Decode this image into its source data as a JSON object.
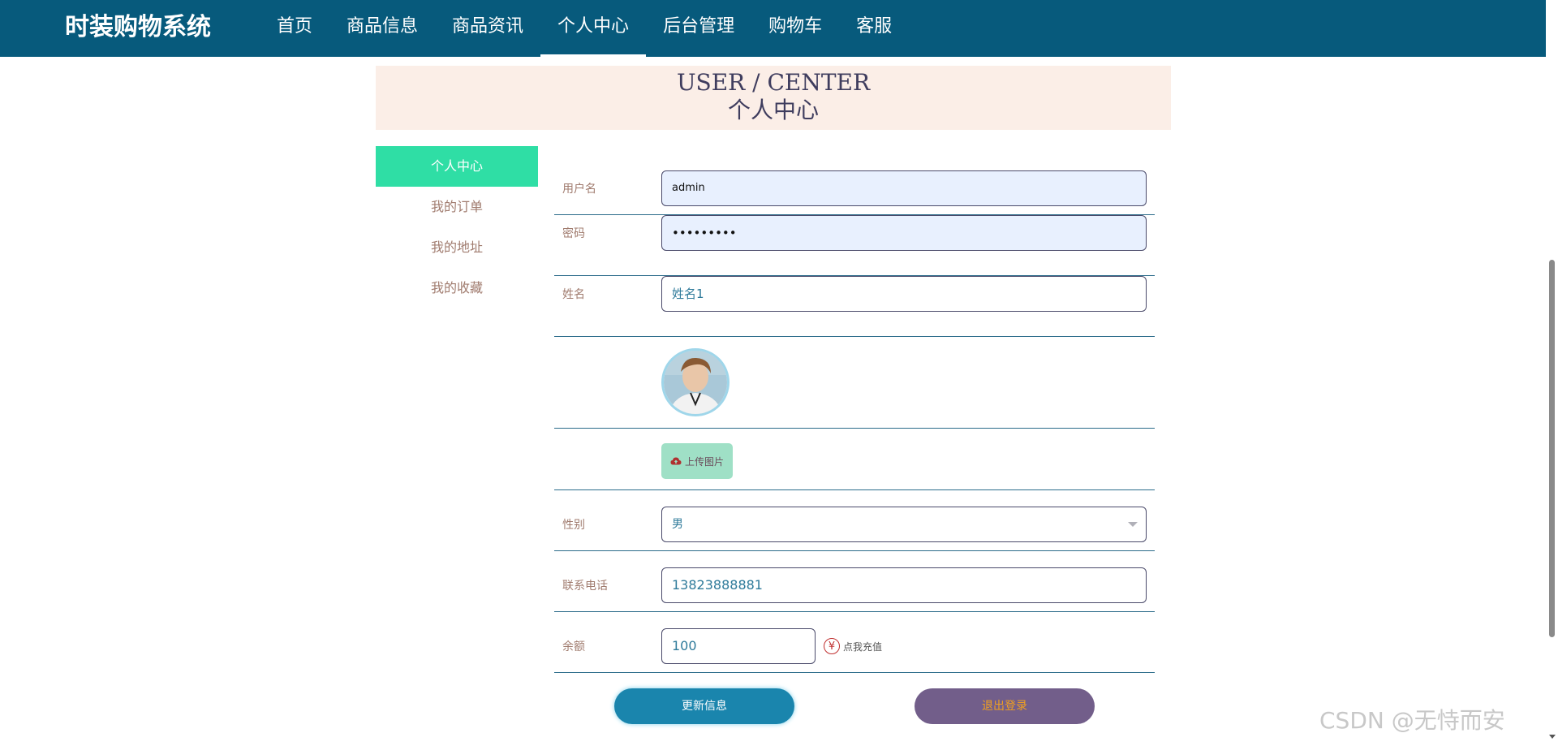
{
  "nav": {
    "brand": "时装购物系统",
    "items": [
      {
        "label": "首页"
      },
      {
        "label": "商品信息"
      },
      {
        "label": "商品资讯"
      },
      {
        "label": "个人中心",
        "active": true
      },
      {
        "label": "后台管理"
      },
      {
        "label": "购物车"
      },
      {
        "label": "客服"
      }
    ]
  },
  "banner": {
    "en": "USER / CENTER",
    "cn": "个人中心"
  },
  "side_menu": [
    {
      "label": "个人中心",
      "active": true
    },
    {
      "label": "我的订单"
    },
    {
      "label": "我的地址"
    },
    {
      "label": "我的收藏"
    }
  ],
  "form": {
    "username": {
      "label": "用户名",
      "value": "admin"
    },
    "password": {
      "label": "密码",
      "value": "•••••••••"
    },
    "name": {
      "label": "姓名",
      "value": "姓名1"
    },
    "upload_label": "上传图片",
    "gender": {
      "label": "性别",
      "value": "男"
    },
    "phone": {
      "label": "联系电话",
      "value": "13823888881"
    },
    "balance": {
      "label": "余额",
      "value": "100",
      "recharge_label": "点我充值"
    }
  },
  "buttons": {
    "update": "更新信息",
    "logout": "退出登录"
  },
  "watermark": "CSDN @无恃而安",
  "colors": {
    "nav_bg": "#075a7c",
    "active_menu": "#2fdea5",
    "banner_bg": "#fbeee7",
    "update_btn": "#1a85ad",
    "logout_btn": "#725e8a"
  }
}
